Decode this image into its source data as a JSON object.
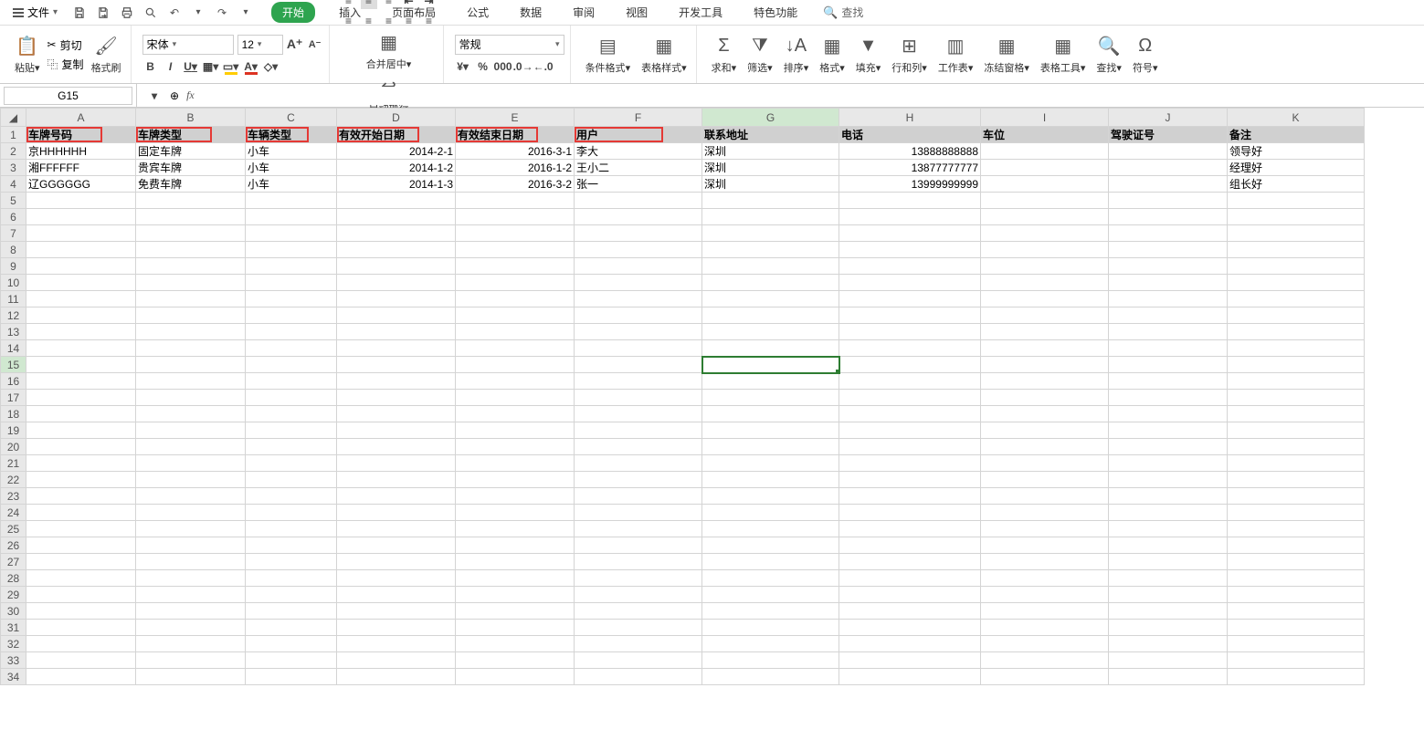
{
  "menu": {
    "file_label": "文件",
    "tabs": [
      "开始",
      "插入",
      "页面布局",
      "公式",
      "数据",
      "审阅",
      "视图",
      "开发工具",
      "特色功能"
    ],
    "search_label": "查找"
  },
  "ribbon": {
    "clipboard": {
      "paste": "粘贴",
      "cut": "剪切",
      "copy": "复制",
      "format_painter": "格式刷"
    },
    "font": {
      "name": "宋体",
      "size": "12"
    },
    "align": {
      "merge": "合并居中",
      "wrap": "自动换行"
    },
    "number": {
      "format": "常规"
    },
    "styles": {
      "cond": "条件格式",
      "table": "表格样式"
    },
    "editing": {
      "sum": "求和",
      "filter": "筛选",
      "sort": "排序",
      "fmt": "格式",
      "fill": "填充",
      "rowcol": "行和列",
      "ws": "工作表",
      "freeze": "冻结窗格",
      "tools": "表格工具",
      "find": "查找",
      "sym": "符号"
    }
  },
  "namebox": "G15",
  "columns": [
    "A",
    "B",
    "C",
    "D",
    "E",
    "F",
    "G",
    "H",
    "I",
    "J",
    "K"
  ],
  "col_classes": [
    "cA",
    "cB",
    "cC",
    "cD",
    "cE",
    "cF",
    "cG",
    "cH",
    "cI",
    "cJ",
    "cK"
  ],
  "headers": [
    "车牌号码",
    "车牌类型",
    "车辆类型",
    "有效开始日期",
    "有效结束日期",
    "用户",
    "联系地址",
    "电话",
    "车位",
    "驾驶证号",
    "备注"
  ],
  "rows": [
    {
      "A": "京HHHHHH",
      "B": "固定车牌",
      "C": "小车",
      "D": "2014-2-1",
      "E": "2016-3-1",
      "F": "李大",
      "G": "深圳",
      "H": "13888888888",
      "I": "",
      "J": "",
      "K": "领导好"
    },
    {
      "A": "湘FFFFFF",
      "B": "贵宾车牌",
      "C": "小车",
      "D": "2014-1-2",
      "E": "2016-1-2",
      "F": "王小二",
      "G": "深圳",
      "H": "13877777777",
      "I": "",
      "J": "",
      "K": "经理好"
    },
    {
      "A": "辽GGGGGG",
      "B": "免费车牌",
      "C": "小车",
      "D": "2014-1-3",
      "E": "2016-3-2",
      "F": "张一",
      "G": "深圳",
      "H": "13999999999",
      "I": "",
      "J": "",
      "K": "组长好"
    }
  ],
  "total_rows": 34,
  "selected": {
    "col": "G",
    "row": 15
  },
  "redboxes": [
    0,
    1,
    2,
    3,
    4,
    5
  ]
}
